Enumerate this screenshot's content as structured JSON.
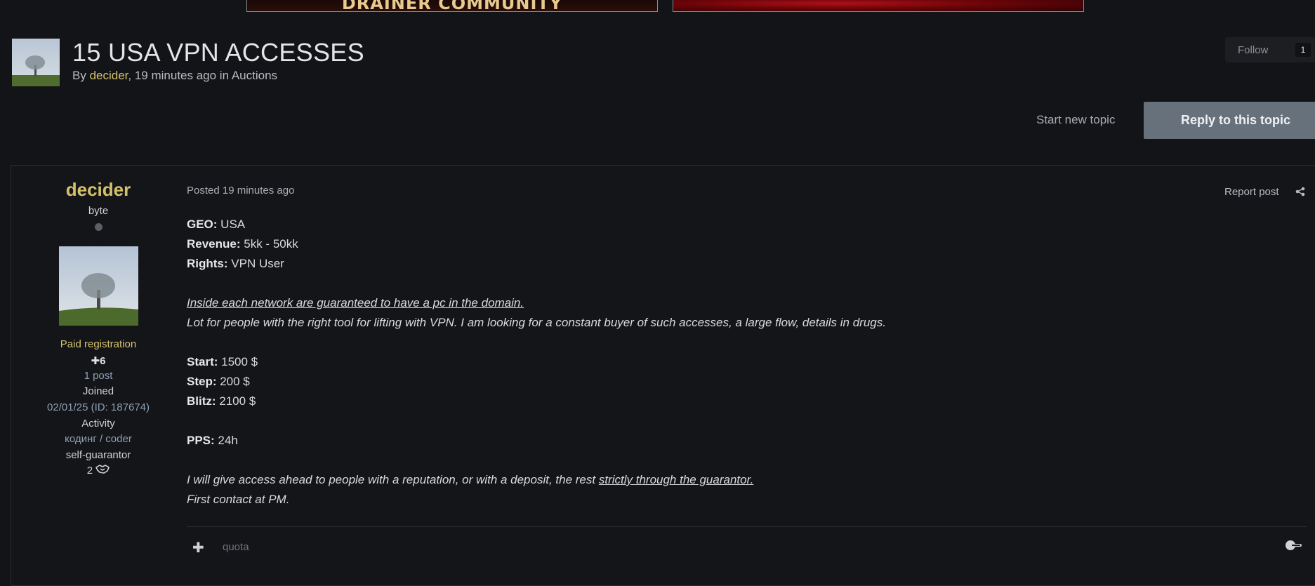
{
  "banners": {
    "left_text": "DRAINER COMMUNITY"
  },
  "topic": {
    "title": "15 USA VPN ACCESSES",
    "meta_prefix": "By ",
    "author": "decider",
    "meta_middle": ", 19 minutes ago in ",
    "forum": "Auctions"
  },
  "follow": {
    "label": "Follow",
    "count": "1"
  },
  "actions": {
    "start_topic": "Start new topic",
    "reply": "Reply to this topic"
  },
  "user": {
    "name": "decider",
    "rank": "byte",
    "group": "Paid registration",
    "reputation": "6",
    "posts": "1 post",
    "joined_label": "Joined",
    "joined": "02/01/25 (ID: 187674)",
    "activity_label": "Activity",
    "activity": "кодинг / coder",
    "guarantor_label": "self-guarantor",
    "deals": "2"
  },
  "post": {
    "posted": "Posted 19 minutes ago",
    "report": "Report post",
    "geo_label": "GEO:",
    "geo": " USA",
    "revenue_label": "Revenue:",
    "revenue": " 5kk - 50kk",
    "rights_label": "Rights:",
    "rights": " VPN User",
    "guarantee_line": "Inside each network are guaranteed to have a pc in the domain.",
    "lot_line": "Lot for people with the right tool for lifting with VPN. I am looking for a constant buyer of such accesses, a large flow, details in drugs.",
    "start_label": "Start:",
    "start": " 1500 $",
    "step_label": "Step:",
    "step": " 200 $",
    "blitz_label": "Blitz:",
    "blitz": " 2100 $",
    "pps_label": "PPS:",
    "pps": " 24h",
    "access_prefix": "I will give access ahead to people with a reputation, or with a deposit, the rest ",
    "access_link": "strictly through the guarantor.",
    "contact_line": "First contact at PM."
  },
  "footer": {
    "plus": "✚",
    "quote": "quota"
  },
  "colors": {
    "background": "#131417",
    "username": "#d4c26a",
    "reply_button": "#67717c"
  }
}
